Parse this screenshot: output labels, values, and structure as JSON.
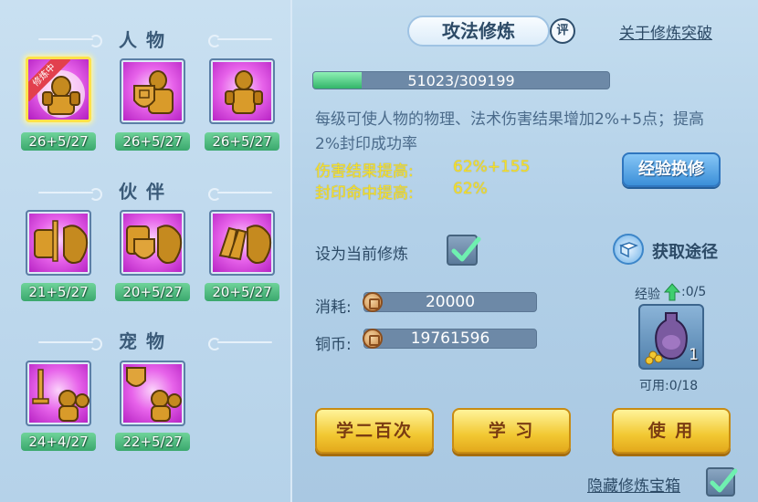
{
  "left": {
    "sections": [
      {
        "title": "人物",
        "slots": [
          {
            "icon": "armored-warrior-icon",
            "level": "26+5/27",
            "ribbon": "修炼中",
            "selected": true
          },
          {
            "icon": "shield-armor-icon",
            "level": "26+5/27"
          },
          {
            "icon": "warrior-armor-icon",
            "level": "26+5/27"
          }
        ]
      },
      {
        "title": "伙伴",
        "slots": [
          {
            "icon": "sword-armor-beast-icon",
            "level": "21+5/27"
          },
          {
            "icon": "shield-armor-beast-icon",
            "level": "20+5/27"
          },
          {
            "icon": "gauntlet-beast-icon",
            "level": "20+5/27"
          }
        ]
      },
      {
        "title": "宠物",
        "slots": [
          {
            "icon": "sword-cat-icon",
            "level": "24+4/27"
          },
          {
            "icon": "shield-cat-icon",
            "level": "22+5/27"
          }
        ]
      }
    ]
  },
  "header": {
    "title": "攻法修炼",
    "review": "评",
    "link": "关于修炼突破"
  },
  "progress": {
    "text": "51023/309199",
    "current": 51023,
    "max": 309199
  },
  "description": "每级可使人物的物理、法术伤害结果增加2%+5点；提高2%封印成功率",
  "stats": [
    {
      "label": "伤害结果提高:",
      "value": "62%+155"
    },
    {
      "label": "封印命中提高:",
      "value": "62%"
    }
  ],
  "exchange_button": "经验换修",
  "set_current_label": "设为当前修炼",
  "set_current_checked": true,
  "obtain_label": "获取途径",
  "cost": {
    "label": "消耗:",
    "value": "20000"
  },
  "coins": {
    "label": "铜币:",
    "value": "19761596"
  },
  "item": {
    "exp_label": "经验",
    "exp_value": ":0/5",
    "count": "1",
    "available": "可用:0/18",
    "icon": "vase-coins-icon"
  },
  "buttons": {
    "train200": "学二百次",
    "learn": "学 习",
    "use": "使 用"
  },
  "hide_box_label": "隐藏修炼宝箱",
  "hide_box_checked": true,
  "colors": {
    "accent_yellow": "#f5e02a",
    "fill_green": "#32b56a",
    "slot_purple": "#e763ea"
  }
}
